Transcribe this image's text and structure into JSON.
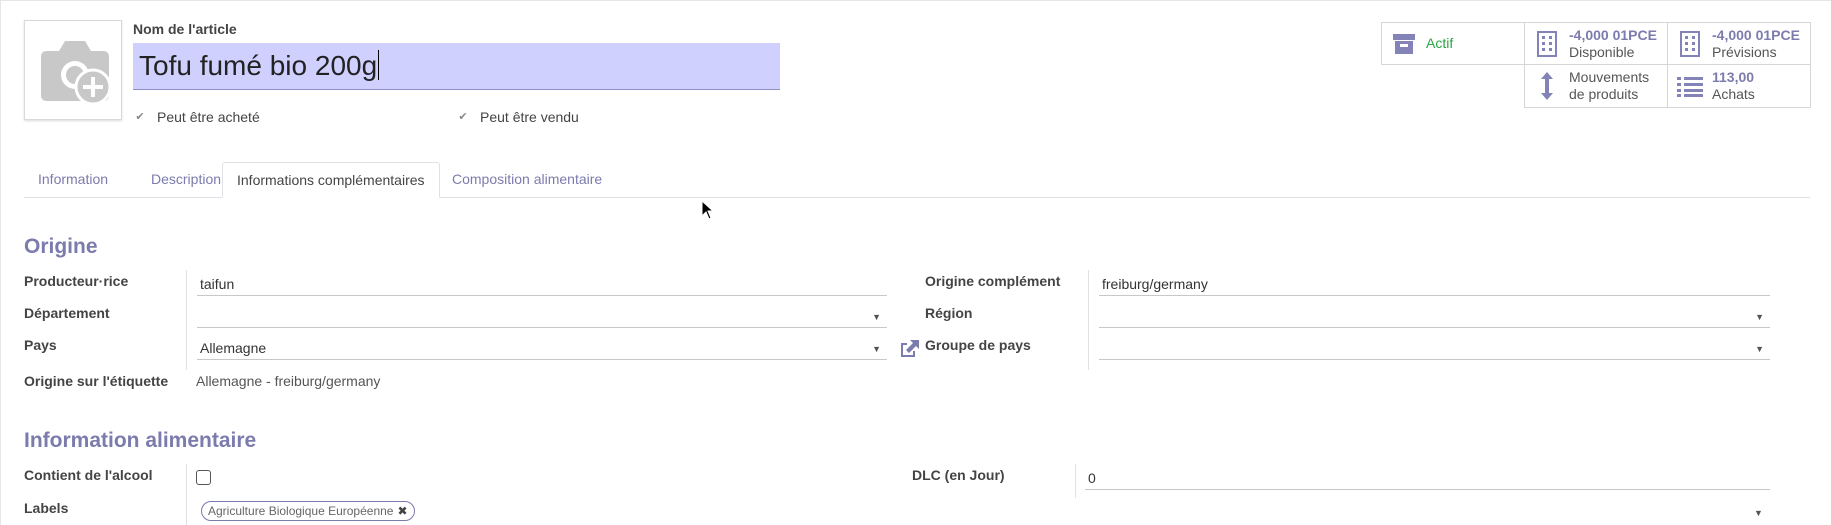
{
  "header": {
    "name_label": "Nom de l'article",
    "name_value": "Tofu fumé bio 200g",
    "can_be_purchased": "Peut être acheté",
    "can_be_sold": "Peut être vendu"
  },
  "smart_buttons": {
    "active": "Actif",
    "available_value": "-4,000 01PCE",
    "available_label": "Disponible",
    "forecast_value": "-4,000 01PCE",
    "forecast_label": "Prévisions",
    "moves_line1": "Mouvements",
    "moves_line2": "de produits",
    "purchases_value": "113,00",
    "purchases_label": "Achats"
  },
  "tabs": [
    "Information",
    "Description",
    "Informations complémentaires",
    "Composition alimentaire"
  ],
  "origin": {
    "title": "Origine",
    "producer_label": "Producteur·rice",
    "producer_value": "taifun",
    "department_label": "Département",
    "department_value": "",
    "country_label": "Pays",
    "country_value": "Allemagne",
    "label_origin_label": "Origine sur l'étiquette",
    "label_origin_value": "Allemagne - freiburg/germany",
    "origin_complement_label": "Origine complément",
    "origin_complement_value": "freiburg/germany",
    "region_label": "Région",
    "region_value": "",
    "country_group_label": "Groupe de pays",
    "country_group_value": ""
  },
  "food": {
    "title": "Information alimentaire",
    "alcohol_label": "Contient de l'alcool",
    "labels_label": "Labels",
    "labels_tags": [
      "Agriculture Biologique Européenne"
    ],
    "dlc_label": "DLC (en Jour)",
    "dlc_value": "0"
  },
  "colors": {
    "accent": "#7c7bad",
    "selection": "#d0d0ff",
    "active_green": "#28a745"
  }
}
